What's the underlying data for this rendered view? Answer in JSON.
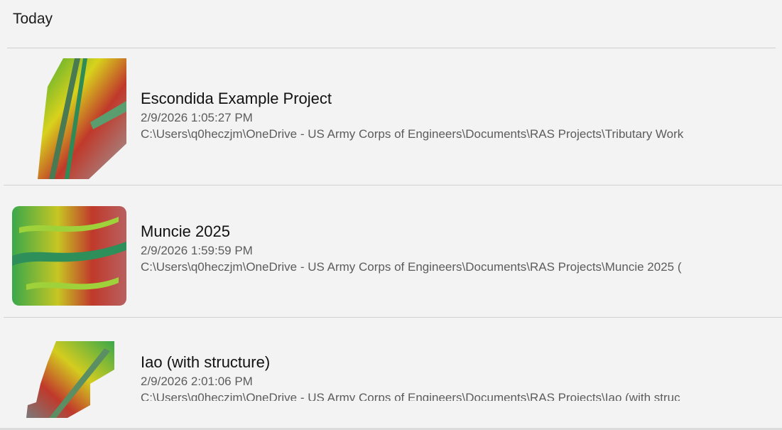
{
  "group": {
    "label": "Today"
  },
  "projects": [
    {
      "title": "Escondida Example Project",
      "timestamp": "2/9/2026 1:05:27 PM",
      "path": "C:\\Users\\q0heczjm\\OneDrive - US Army Corps of Engineers\\Documents\\RAS Projects\\Tributary Work",
      "thumbnail": "terrain-map-thumbnail"
    },
    {
      "title": "Muncie 2025",
      "timestamp": "2/9/2026 1:59:59 PM",
      "path": "C:\\Users\\q0heczjm\\OneDrive - US Army Corps of Engineers\\Documents\\RAS Projects\\Muncie 2025 (",
      "thumbnail": "terrain-map-thumbnail"
    },
    {
      "title": "Iao (with structure)",
      "timestamp": "2/9/2026 2:01:06 PM",
      "path": "C:\\Users\\q0heczjm\\OneDrive - US Army Corps of Engineers\\Documents\\RAS Projects\\Iao (with struc",
      "thumbnail": "terrain-map-thumbnail"
    }
  ]
}
